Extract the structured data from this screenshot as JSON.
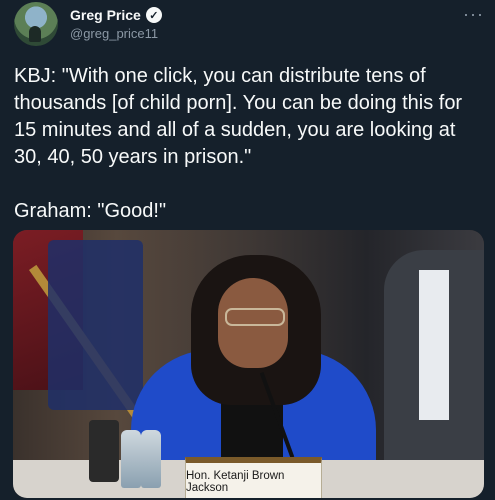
{
  "author": {
    "display_name": "Greg Price",
    "handle": "@greg_price11",
    "verified_icon": "✓"
  },
  "more_icon": "···",
  "tweet": {
    "text": "KBJ: \"With one click, you can distribute tens of thousands [of child porn]. You can be doing this for 15 minutes and all of a sudden, you are looking at 30, 40, 50 years in prison.\"\n\nGraham: \"Good!\""
  },
  "media": {
    "nameplate_text": "Hon. Ketanji Brown Jackson"
  },
  "colors": {
    "background": "#15202b",
    "text_primary": "#f7f9f9",
    "text_secondary": "#8b98a5",
    "jacket_blue": "#1f4bc9"
  }
}
